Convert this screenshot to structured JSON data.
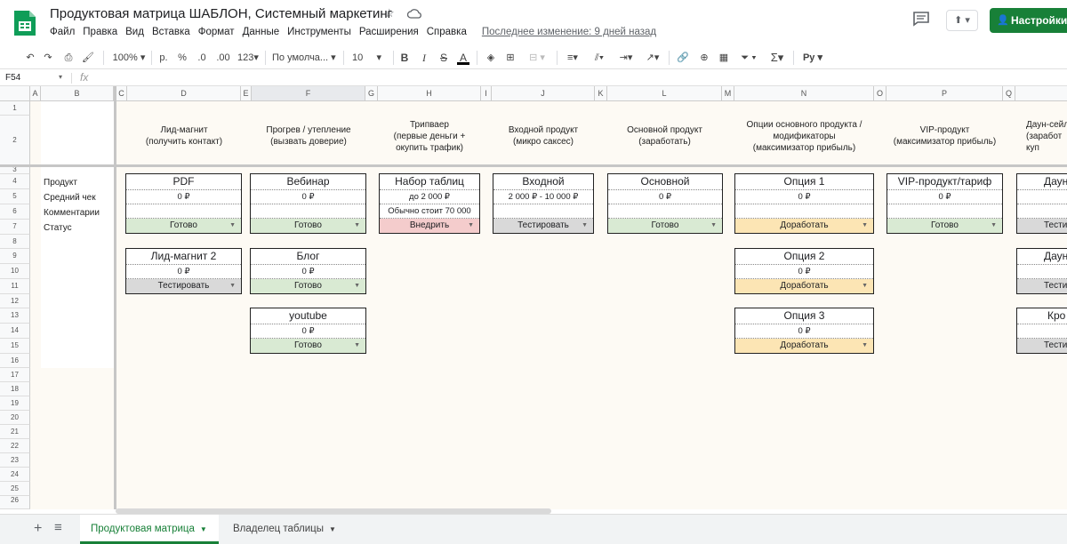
{
  "title": "Продуктовая матрица ШАБЛОН, Системный маркетинг",
  "menu": [
    "Файл",
    "Правка",
    "Вид",
    "Вставка",
    "Формат",
    "Данные",
    "Инструменты",
    "Расширения",
    "Справка"
  ],
  "last_edit": "Последнее изменение: 9 дней назад",
  "access_button": "Настройки Д",
  "toolbar": {
    "zoom": "100%",
    "currency": "р.",
    "percent": "%",
    "decrease_decimals": ".0",
    "increase_decimals": ".00",
    "more_formats": "123",
    "font": "По умолча...",
    "font_size": "10",
    "bold": "B",
    "italic": "I",
    "strike": "S",
    "text_color": "A",
    "sum": "Σ",
    "input_tools": "Pу"
  },
  "formula_bar": {
    "cell": "F54",
    "fx": "fx"
  },
  "columns": [
    "A",
    "B",
    "C",
    "D",
    "E",
    "F",
    "G",
    "H",
    "I",
    "J",
    "K",
    "L",
    "M",
    "N",
    "O",
    "P",
    "Q"
  ],
  "rows": [
    "1",
    "2",
    "3",
    "4",
    "5",
    "6",
    "7",
    "8",
    "9",
    "10",
    "11",
    "12",
    "13",
    "14",
    "15",
    "16",
    "17",
    "18",
    "19",
    "20",
    "21",
    "22",
    "23",
    "24",
    "25",
    "26"
  ],
  "row_labels": [
    "Продукт",
    "Средний чек",
    "Комментарии",
    "Статус"
  ],
  "stages": [
    "Лид-магнит\n(получить контакт)",
    "Прогрев / утепление\n(вызвать доверие)",
    "Трипваер\n(первые деньги +\nокупить трафик)",
    "Входной продукт\n(микро саксес)",
    "Основной продукт\n(заработать)",
    "Опции основного продукта /\nмодификаторы\n(максимизатор прибыль)",
    "VIP-продукт\n(максимизатор прибыль)",
    "Даун-сейл\n(заработ\nкуп"
  ],
  "cards": [
    {
      "title": "PDF",
      "price": "0 ₽",
      "comment": "",
      "status": "Готово"
    },
    {
      "title": "Лид-магнит 2",
      "price": "0 ₽",
      "comment": "",
      "status": "Тестировать"
    },
    {
      "title": "Вебинар",
      "price": "0 ₽",
      "comment": "",
      "status": "Готово"
    },
    {
      "title": "Блог",
      "price": "0 ₽",
      "comment": "",
      "status": "Готово"
    },
    {
      "title": "youtube",
      "price": "0 ₽",
      "comment": "",
      "status": "Готово"
    },
    {
      "title": "Набор таблиц",
      "price": "до 2 000 ₽",
      "comment": "Обычно стоит 70 000",
      "status": "Внедрить"
    },
    {
      "title": "Входной",
      "price": "2 000 ₽ - 10 000 ₽",
      "comment": "",
      "status": "Тестировать"
    },
    {
      "title": "Основной",
      "price": "0 ₽",
      "comment": "",
      "status": "Готово"
    },
    {
      "title": "Опция 1",
      "price": "0 ₽",
      "comment": "",
      "status": "Доработать"
    },
    {
      "title": "Опция 2",
      "price": "0 ₽",
      "comment": "",
      "status": "Доработать"
    },
    {
      "title": "Опция 3",
      "price": "0 ₽",
      "comment": "",
      "status": "Доработать"
    },
    {
      "title": "VIP-продукт/тариф",
      "price": "0 ₽",
      "comment": "",
      "status": "Готово"
    },
    {
      "title": "Даун",
      "price": "",
      "comment": "",
      "status": "Тести"
    },
    {
      "title": "Даун",
      "price": "",
      "comment": "",
      "status": "Тести"
    },
    {
      "title": "Кро",
      "price": "",
      "comment": "",
      "status": "Тести"
    }
  ],
  "sheet_tabs": [
    "Продуктовая матрица",
    "Владелец таблицы"
  ],
  "colors": {
    "accent": "#188038",
    "ready": "#d9ead3",
    "test": "#d9d9d9",
    "implement": "#f4cccc",
    "rework": "#fce5b4",
    "background": "#fdfaf4"
  }
}
